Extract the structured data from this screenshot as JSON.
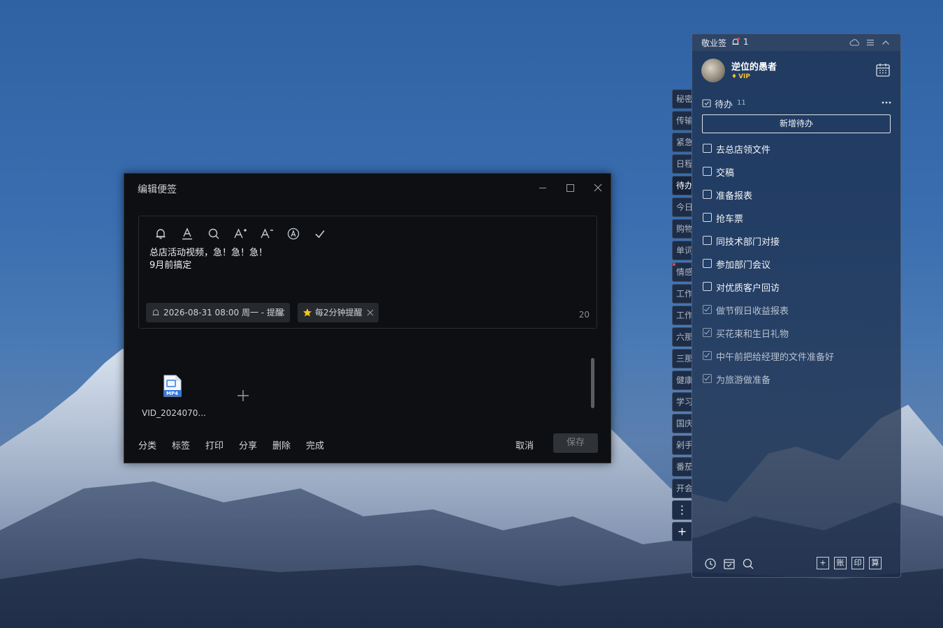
{
  "editor": {
    "title": "编辑便签",
    "note_lines": [
      "总店活动视频，急！急！急！",
      "9月前搞定"
    ],
    "reminder_chip": "2026-08-31 08:00 周一 - 提醒",
    "repeat_chip": "每2分钟提醒",
    "char_count": "20",
    "attachment": {
      "badge": "MP4",
      "name": "VID_2024070..."
    },
    "actions": [
      "分类",
      "标签",
      "打印",
      "分享",
      "删除",
      "完成"
    ],
    "cancel": "取消",
    "save": "保存"
  },
  "tabs": [
    "秘密",
    "传输",
    "紧急",
    "日程",
    "待办",
    "今日",
    "购物",
    "单词",
    "情感",
    "工作",
    "工作",
    "六那",
    "三那",
    "健康",
    "学习",
    "国庆",
    "剁手",
    "番茄",
    "开会"
  ],
  "tab_buttons": [
    "⋮",
    "+"
  ],
  "panel": {
    "app_name": "敬业签",
    "notification_count": "1",
    "user_name": "逆位的愚者",
    "vip": "VIP",
    "todo_title": "待办",
    "todo_count": "11",
    "new_todo": "新增待办",
    "todos": [
      {
        "text": "去总店领文件",
        "done": false
      },
      {
        "text": "交稿",
        "done": false
      },
      {
        "text": "准备报表",
        "done": false
      },
      {
        "text": "抢车票",
        "done": false
      },
      {
        "text": "同技术部门对接",
        "done": false
      },
      {
        "text": "参加部门会议",
        "done": false
      },
      {
        "text": "对优质客户回访",
        "done": false
      },
      {
        "text": "做节假日收益报表",
        "done": true
      },
      {
        "text": "买花束和生日礼物",
        "done": true
      },
      {
        "text": "中午前把给经理的文件准备好",
        "done": true
      },
      {
        "text": "为旅游做准备",
        "done": true
      }
    ],
    "footer_boxes": [
      "+",
      "账",
      "印",
      "算"
    ]
  },
  "colors": {
    "accent_vip": "#f2c230",
    "notify_red": "#e04a3c",
    "editor_bg": "#0d0f12"
  }
}
